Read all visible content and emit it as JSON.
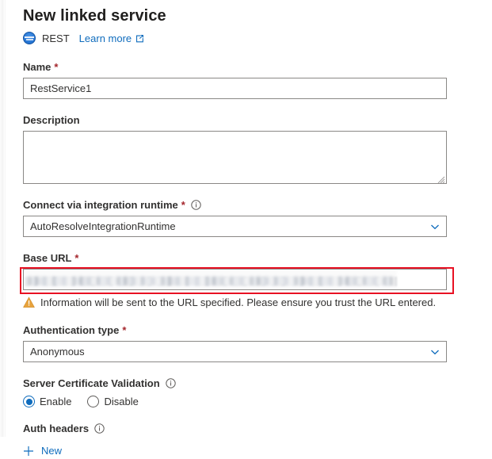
{
  "header": {
    "title": "New linked service",
    "connector_icon": "rest-globe-icon",
    "connector_label": "REST",
    "learn_more_label": "Learn more",
    "learn_more_icon": "external-link-icon"
  },
  "fields": {
    "name": {
      "label": "Name",
      "required_marker": "*",
      "value": "RestService1",
      "placeholder": ""
    },
    "description": {
      "label": "Description",
      "value": "",
      "placeholder": ""
    },
    "integration_runtime": {
      "label": "Connect via integration runtime",
      "required_marker": "*",
      "info_icon": "info-icon",
      "value": "AutoResolveIntegrationRuntime",
      "chevron_icon": "chevron-down-icon"
    },
    "base_url": {
      "label": "Base URL",
      "required_marker": "*",
      "value": "",
      "placeholder": "",
      "redacted": true,
      "highlight_color": "#e81123"
    },
    "warning": {
      "icon": "warning-triangle-icon",
      "text": "Information will be sent to the URL specified. Please ensure you trust the URL entered."
    },
    "authentication_type": {
      "label": "Authentication type",
      "required_marker": "*",
      "value": "Anonymous",
      "chevron_icon": "chevron-down-icon"
    },
    "server_certificate_validation": {
      "label": "Server Certificate Validation",
      "info_icon": "info-icon",
      "options": [
        {
          "label": "Enable",
          "selected": true
        },
        {
          "label": "Disable",
          "selected": false
        }
      ]
    },
    "auth_headers": {
      "label": "Auth headers",
      "info_icon": "info-icon",
      "new_label": "New",
      "new_icon": "plus-icon"
    }
  },
  "colors": {
    "accent": "#0f6cbd",
    "required": "#a4262c",
    "warning": "#e8a33d",
    "highlight": "#e81123",
    "text": "#323130",
    "border": "#8a8886"
  }
}
